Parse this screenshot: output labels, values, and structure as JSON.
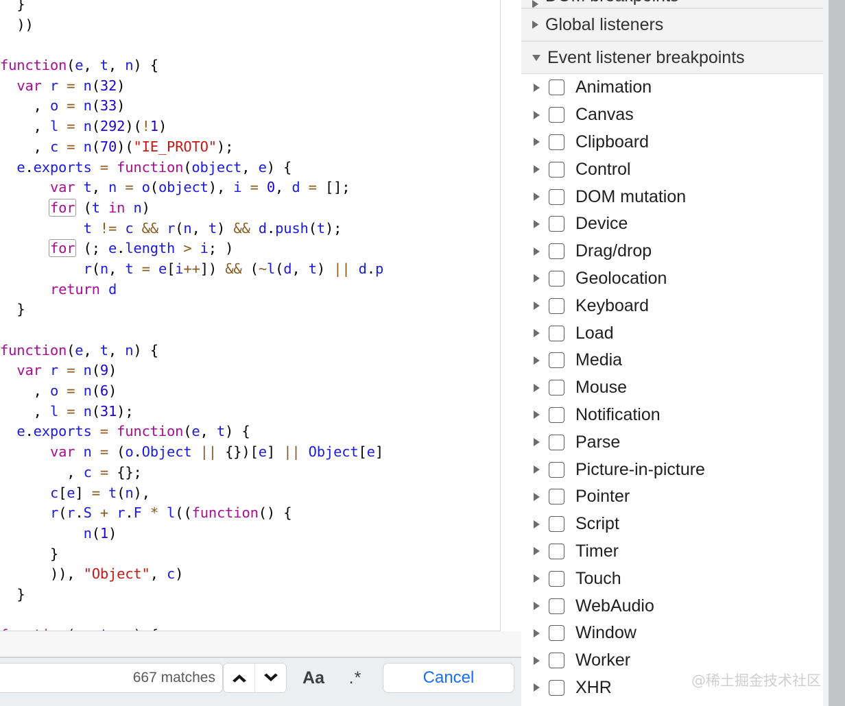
{
  "code_pane": {
    "name": "source-code-viewer",
    "language": "javascript",
    "lines": [
      "  }",
      "  ))",
      "",
      "function(e, t, n) {",
      "  var r = n(32)",
      "    , o = n(33)",
      "    , l = n(292)(!1)",
      "    , c = n(70)(\"IE_PROTO\");",
      "  e.exports = function(object, e) {",
      "      var t, n = o(object), i = 0, d = [];",
      "      for (t in n)",
      "          t != c && r(n, t) && d.push(t);",
      "      for (; e.length > i; )",
      "          r(n, t = e[i++]) && (~l(d, t) || d.p",
      "      return d",
      "  }",
      "",
      "function(e, t, n) {",
      "  var r = n(9)",
      "    , o = n(6)",
      "    , l = n(31);",
      "  e.exports = function(e, t) {",
      "      var n = (o.Object || {})[e] || Object[e]",
      "        , c = {};",
      "      c[e] = t(n),",
      "      r(r.S + r.F * l((function() {",
      "          n(1)",
      "      }",
      "      )), \"Object\", c)",
      "  }",
      "",
      "function(e, t, n) {"
    ],
    "search_match_token": "for"
  },
  "search_bar": {
    "match_count_label": "667 matches",
    "input_value": "",
    "input_placeholder": "",
    "prev_icon": "chevron-up-icon",
    "next_icon": "chevron-down-icon",
    "match_case_label": "Aa",
    "regex_label": ".*",
    "cancel_label": "Cancel",
    "cancel_color": "#1a6ef5"
  },
  "sidebar": {
    "sections": [
      {
        "id": "dom-breakpoints",
        "label": "DOM breakpoints",
        "expanded": false,
        "cut_off": true
      },
      {
        "id": "global-listeners",
        "label": "Global listeners",
        "expanded": false,
        "cut_off": false
      },
      {
        "id": "event-listener-breakpoints",
        "label": "Event listener breakpoints",
        "expanded": true,
        "cut_off": false
      }
    ],
    "event_listener_breakpoints": [
      {
        "label": "Animation",
        "checked": false
      },
      {
        "label": "Canvas",
        "checked": false
      },
      {
        "label": "Clipboard",
        "checked": false
      },
      {
        "label": "Control",
        "checked": false
      },
      {
        "label": "DOM mutation",
        "checked": false
      },
      {
        "label": "Device",
        "checked": false
      },
      {
        "label": "Drag/drop",
        "checked": false
      },
      {
        "label": "Geolocation",
        "checked": false
      },
      {
        "label": "Keyboard",
        "checked": false
      },
      {
        "label": "Load",
        "checked": false
      },
      {
        "label": "Media",
        "checked": false
      },
      {
        "label": "Mouse",
        "checked": false
      },
      {
        "label": "Notification",
        "checked": false
      },
      {
        "label": "Parse",
        "checked": false
      },
      {
        "label": "Picture-in-picture",
        "checked": false
      },
      {
        "label": "Pointer",
        "checked": false
      },
      {
        "label": "Script",
        "checked": false
      },
      {
        "label": "Timer",
        "checked": false
      },
      {
        "label": "Touch",
        "checked": false
      },
      {
        "label": "WebAudio",
        "checked": false
      },
      {
        "label": "Window",
        "checked": false
      },
      {
        "label": "Worker",
        "checked": false
      },
      {
        "label": "XHR",
        "checked": false
      }
    ]
  },
  "watermark": {
    "text": "@稀土掘金技术社区"
  },
  "colors": {
    "keyword": "#aa0d91",
    "identifier": "#1a1ae0",
    "number": "#1c00cf",
    "string": "#c41a16",
    "operator": "#8a5a20",
    "link": "#1a6ef5",
    "panel_header_bg": "#f3f3f3",
    "toolbar_bg": "#eceff1"
  }
}
